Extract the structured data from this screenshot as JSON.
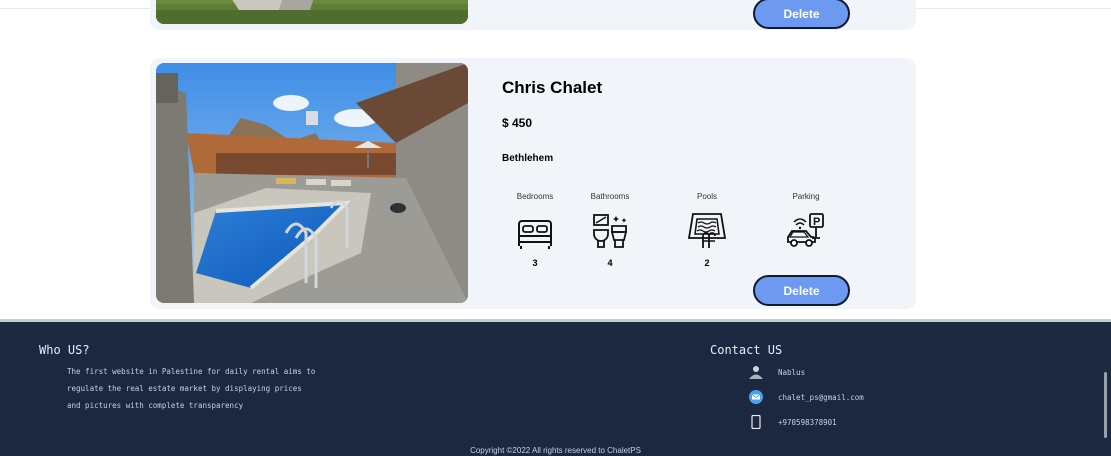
{
  "listings": {
    "previous": {
      "delete_label": "Delete"
    },
    "current": {
      "title": "Chris Chalet",
      "price": "$ 450",
      "city": "Bethlehem",
      "delete_label": "Delete",
      "amenities": [
        {
          "label": "Bedrooms",
          "icon": "bed-icon",
          "count": "3"
        },
        {
          "label": "Bathrooms",
          "icon": "bathroom-icon",
          "count": "4"
        },
        {
          "label": "Pools",
          "icon": "pool-icon",
          "count": "2"
        },
        {
          "label": "Parking",
          "icon": "parking-icon",
          "count": ""
        }
      ]
    }
  },
  "footer": {
    "who_title": "Who US?",
    "who_lines": [
      "The first website in Palestine for daily rental aims to",
      "regulate the real estate market by displaying prices",
      "and pictures with complete transparency"
    ],
    "contact_title": "Contact US",
    "contacts": [
      {
        "icon": "person-icon",
        "text": "Nablus"
      },
      {
        "icon": "email-icon",
        "text": "chalet_ps@gmail.com"
      },
      {
        "icon": "phone-icon",
        "text": "+970598378901"
      }
    ],
    "copyright": "Copyright ©2022 All rights reserved to ChaletPS"
  },
  "colors": {
    "accent": "#6d9af0",
    "footer_bg": "#1c2840",
    "card_bg": "#f1f4f8"
  }
}
